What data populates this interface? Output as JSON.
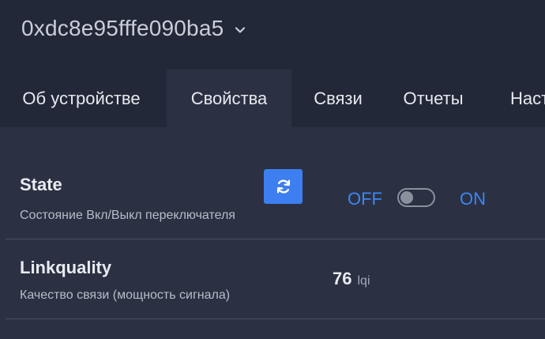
{
  "header": {
    "device_id": "0xdc8e95fffe090ba5"
  },
  "tabs": [
    {
      "label": "Об устройстве"
    },
    {
      "label": "Свойства"
    },
    {
      "label": "Связи"
    },
    {
      "label": "Отчеты"
    },
    {
      "label": "Наст"
    }
  ],
  "active_tab": "Свойства",
  "exposes": [
    {
      "title": "State",
      "description": "Состояние Вкл/Выкл переключателя",
      "off_label": "OFF",
      "on_label": "ON",
      "state": "off",
      "refresh_icon": "refresh-icon"
    },
    {
      "title": "Linkquality",
      "description": "Качество связи (мощность сигнала)",
      "value": "76",
      "unit": "lqi"
    }
  ],
  "colors": {
    "accent": "#3d7ff0",
    "header_bg": "#222838",
    "content_bg": "#2b3143"
  }
}
